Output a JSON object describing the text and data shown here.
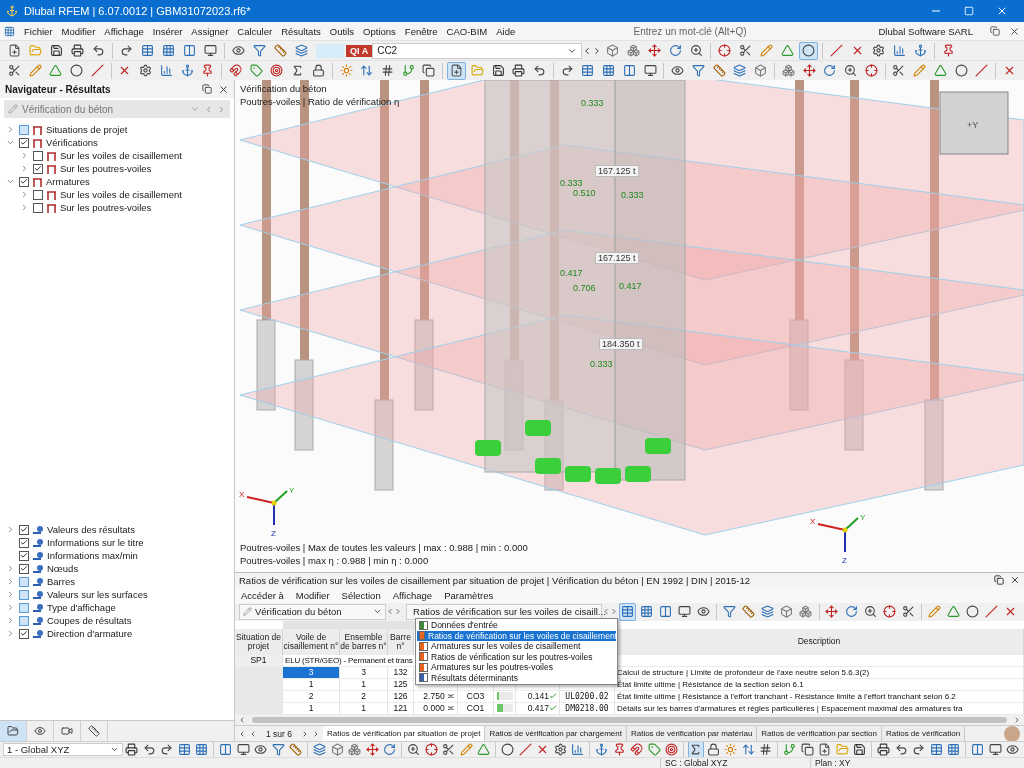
{
  "window": {
    "title": "Dlubal RFEM | 6.07.0012 | GBM31072023.rf6*"
  },
  "menu": [
    "Fichier",
    "Modifier",
    "Affichage",
    "Insérer",
    "Assigner",
    "Calculer",
    "Résultats",
    "Outils",
    "Options",
    "Fenêtre",
    "CAO-BIM",
    "Aide"
  ],
  "search": {
    "placeholder": "Entrez un mot-clé (Alt+Q)"
  },
  "company": "Dlubal Software SARL",
  "load_case": {
    "badge": "QI A",
    "value": "CC2"
  },
  "navigator": {
    "title": "Navigateur - Résultats",
    "combo": "Vérification du béton",
    "tree": [
      {
        "label": "Situations de projet",
        "checked": false,
        "partial": true,
        "expanded": false
      },
      {
        "label": "Vérifications",
        "checked": true,
        "partial": false,
        "expanded": true,
        "children": [
          {
            "label": "Sur les voiles de cisaillement",
            "checked": false,
            "partial": false,
            "expanded": false
          },
          {
            "label": "Sur les poutres-voiles",
            "checked": true,
            "partial": false,
            "expanded": false
          }
        ]
      },
      {
        "label": "Armatures",
        "checked": true,
        "partial": false,
        "expanded": true,
        "children": [
          {
            "label": "Sur les voiles de cisaillement",
            "checked": false,
            "partial": false,
            "expanded": false
          },
          {
            "label": "Sur les poutres-voiles",
            "checked": false,
            "partial": false,
            "expanded": false
          }
        ]
      }
    ],
    "display": [
      {
        "label": "Valeurs des résultats",
        "checked": true,
        "expandable": true
      },
      {
        "label": "Informations sur le titre",
        "checked": true,
        "expandable": false
      },
      {
        "label": "Informations max/min",
        "checked": true,
        "expandable": false
      },
      {
        "label": "Nœuds",
        "checked": true,
        "expandable": true
      },
      {
        "label": "Barres",
        "checked": false,
        "expandable": true
      },
      {
        "label": "Valeurs sur les surfaces",
        "checked": false,
        "expandable": true
      },
      {
        "label": "Type d'affichage",
        "checked": false,
        "expandable": true
      },
      {
        "label": "Coupes de résultats",
        "checked": false,
        "expandable": true
      },
      {
        "label": "Direction d'armature",
        "checked": true,
        "expandable": true
      }
    ],
    "tabs": [
      {
        "selected": true
      },
      {
        "selected": false
      },
      {
        "selected": false
      },
      {
        "selected": false
      }
    ]
  },
  "viewport": {
    "title_lines": [
      "Vérification du béton",
      "Poutres-voiles | Ratio de vérification η"
    ],
    "labels": [
      {
        "text": "0.333",
        "kind": "ratio"
      },
      {
        "text": "167.125 t",
        "kind": "weight"
      },
      {
        "text": "0.333",
        "kind": "ratio"
      },
      {
        "text": "0.510",
        "kind": "ratio"
      },
      {
        "text": "0.333",
        "kind": "ratio"
      },
      {
        "text": "167.125 t",
        "kind": "weight"
      },
      {
        "text": "0.417",
        "kind": "ratio"
      },
      {
        "text": "0.706",
        "kind": "ratio"
      },
      {
        "text": "0.417",
        "kind": "ratio"
      },
      {
        "text": "184.350 t",
        "kind": "weight"
      },
      {
        "text": "0.333",
        "kind": "ratio"
      }
    ],
    "cube_label": "+Y",
    "axes": [
      "X",
      "Y",
      "Z",
      "X",
      "Y",
      "Z"
    ],
    "footer_lines": [
      "Poutres-voiles | Max de toutes les valeurs | max  : 0.988 | min  : 0.000",
      "Poutres-voiles | max η : 0.988 | min η : 0.000"
    ]
  },
  "results": {
    "title": "Ratios de vérification sur les voiles de cisaillement par situation de projet | Vérification du béton | EN 1992 | DIN | 2015-12",
    "menu": [
      "Accéder à",
      "Modifier",
      "Sélection",
      "Affichage",
      "Paramètres"
    ],
    "module_combo": "Vérification du béton",
    "table_combo": "Ratios de vérification sur les voiles de cisaill...",
    "dropdown": [
      {
        "label": "Données d'entrée",
        "selected": false,
        "color": "#3a8a3a"
      },
      {
        "label": "Ratios de vérification sur les voiles de cisaillement",
        "selected": true,
        "color": "#e8641e"
      },
      {
        "label": "Armatures sur les voiles de cisaillement",
        "selected": false,
        "color": "#e8641e"
      },
      {
        "label": "Ratios de vérification sur les poutres-voiles",
        "selected": false,
        "color": "#e8641e"
      },
      {
        "label": "Armatures sur les poutres-voiles",
        "selected": false,
        "color": "#e8641e"
      },
      {
        "label": "Résultats déterminants",
        "selected": false,
        "color": "#3a5fa8"
      }
    ],
    "columns": [
      "Situation de projet",
      "Voile de cisaillement n°",
      "Ensemble de barres n°",
      "Barre n°",
      "Description"
    ],
    "group": {
      "situation": "SP1",
      "label": "ELU (STR/GEO) - Permanent et trans"
    },
    "rows": [
      {
        "wall": "3",
        "set": "3",
        "bar": "132",
        "selected": true,
        "description": "Calcul de structure | Limite de profondeur de l'axe neutre selon 5.6.3(2)"
      },
      {
        "wall": "1",
        "set": "1",
        "bar": "125",
        "selected": false,
        "description": "État limite ultime | Résistance de la section selon 6.1"
      },
      {
        "wall": "2",
        "set": "2",
        "bar": "126",
        "selected": false,
        "location": "2.750 ≍",
        "combination": "CO3",
        "level": 0.141,
        "ratio": "0.141",
        "code": "UL0200.02",
        "description": "État limite ultime | Résistance à l'effort tranchant - Résistance limite à l'effort tranchant selon 6.2"
      },
      {
        "wall": "1",
        "set": "1",
        "bar": "121",
        "selected": false,
        "location": "0.000 ≍",
        "combination": "CO1",
        "level": 0.417,
        "ratio": "0.417",
        "code": "DM0218.00",
        "description": "Détails sur les barres d'armatures et règles particulières | Espacement maximal des armatures tra"
      }
    ]
  },
  "pager": "1 sur 6",
  "tabs": [
    {
      "label": "Ratios de vérification par situation de projet",
      "selected": true
    },
    {
      "label": "Ratios de vérification par chargement",
      "selected": false
    },
    {
      "label": "Ratios de vérification par matériau",
      "selected": false
    },
    {
      "label": "Ratios de vérification par section",
      "selected": false
    },
    {
      "label": "Ratios de vérification",
      "selected": false
    }
  ],
  "coordinate_system": "1 - Global XYZ",
  "status": [
    "SC : Global XYZ",
    "Plan : XY"
  ]
}
